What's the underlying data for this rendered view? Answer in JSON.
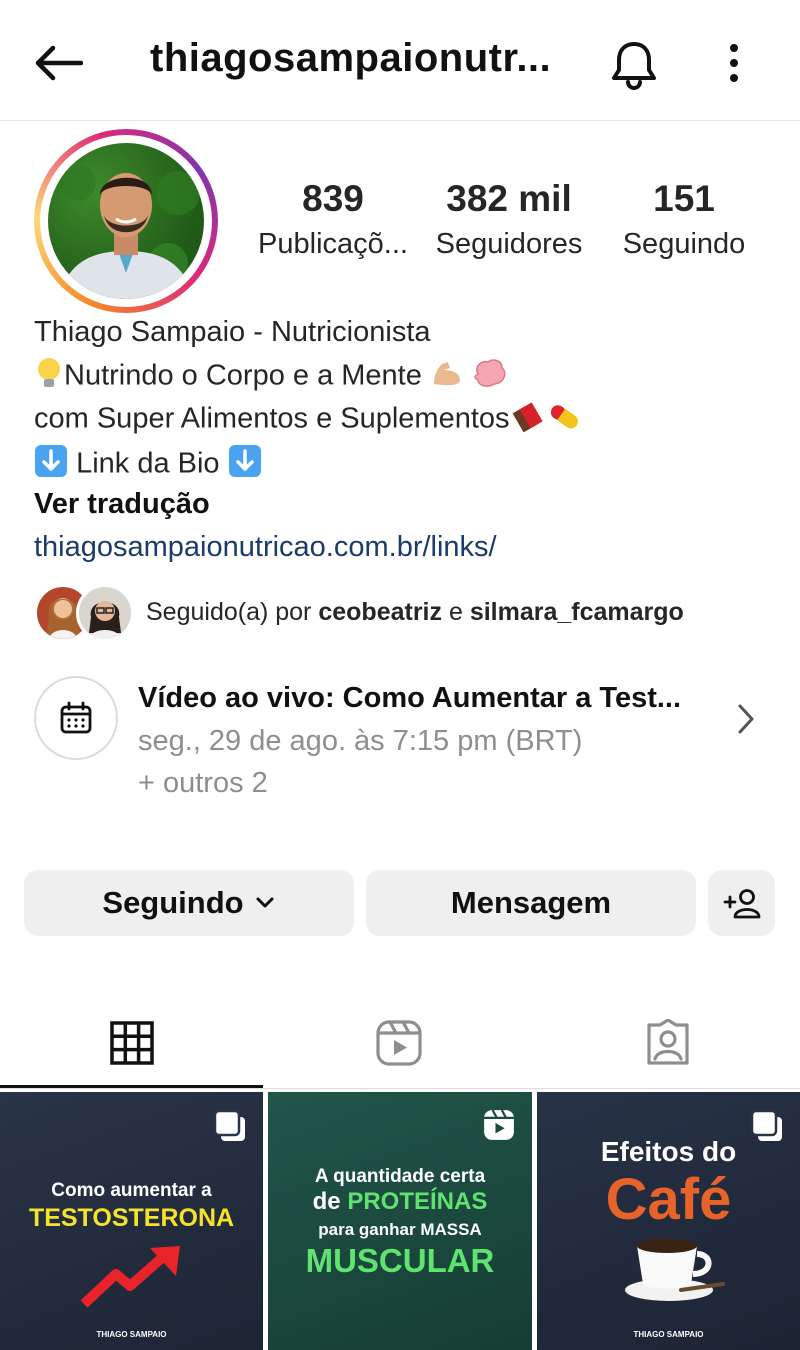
{
  "header": {
    "username": "thiagosampaionutr...",
    "icons": [
      "back-arrow-icon",
      "bell-icon",
      "more-vertical-icon"
    ]
  },
  "profile": {
    "stats": [
      {
        "value": "839",
        "label": "Publicaçõ..."
      },
      {
        "value": "382 mil",
        "label": "Seguidores"
      },
      {
        "value": "151",
        "label": "Seguindo"
      }
    ],
    "name": "Thiago Sampaio - Nutricionista",
    "bio_line1": "Nutrindo o Corpo e a Mente",
    "bio_line2": "com Super Alimentos e Suplementos",
    "bio_line3": "Link da Bio",
    "translate": "Ver tradução",
    "link": "thiagosampaionutricao.com.br/links/"
  },
  "followed_by": {
    "prefix": "Seguido(a) por",
    "user1": "ceobeatriz",
    "connector": "e",
    "user2": "silmara_fcamargo"
  },
  "event": {
    "title": "Vídeo ao vivo: Como Aumentar a Test...",
    "date": "seg., 29 de ago. às 7:15 pm (BRT)",
    "more": "+ outros 2"
  },
  "actions": {
    "following": "Seguindo",
    "message": "Mensagem"
  },
  "tabs": [
    "grid-icon",
    "reels-icon",
    "tagged-icon"
  ],
  "posts": [
    {
      "line1": "Como aumentar a",
      "line2": "TESTOSTERONA",
      "brand": "THIAGO SAMPAIO"
    },
    {
      "line1": "A quantidade certa",
      "line2a": "de",
      "line2b": "PROTEÍNAS",
      "line3": "para ganhar MASSA",
      "line4": "MUSCULAR"
    },
    {
      "line1": "Efeitos do",
      "line2": "Café",
      "brand": "THIAGO SAMPAIO"
    }
  ],
  "colors": {
    "link": "#1c3b6b",
    "button_bg": "#efefef",
    "post_dark": "#1f2838",
    "post_green": "#1b4a3e",
    "accent_yellow": "#f5e22a",
    "accent_green": "#5fe26f",
    "accent_orange": "#e8632a"
  }
}
